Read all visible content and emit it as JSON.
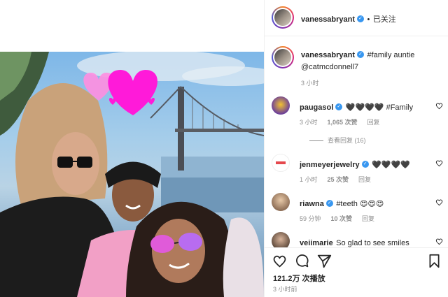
{
  "header": {
    "username": "vanessabryant",
    "separator": "•",
    "follow_state": "已关注"
  },
  "caption": {
    "username": "vanessabryant",
    "hashtag": "#family",
    "text": " auntie",
    "mention": "@catmcdonnell7",
    "time": "3 小时"
  },
  "comments": [
    {
      "username": "paugasol",
      "text": "🖤🖤🖤🖤 #Family",
      "time": "3 小时",
      "likes": "1,065 次赞",
      "reply": "回复",
      "view_replies": "查看回复 (16)"
    },
    {
      "username": "jenmeyerjewelry",
      "text": "🖤🖤🖤🖤",
      "time": "1 小时",
      "likes": "25 次赞",
      "reply": "回复"
    },
    {
      "username": "riawna",
      "text": "#teeth 😍😍😍",
      "time": "59 分钟",
      "likes": "10 次赞",
      "reply": "回复"
    },
    {
      "username": "veiimarie",
      "text": "So glad to see smiles"
    }
  ],
  "footer": {
    "likes": "121.2万 次播放",
    "time": "3 小时前"
  },
  "icons": {
    "like": "heart-outline-icon",
    "comment": "comment-bubble-icon",
    "share": "paper-plane-icon",
    "save": "bookmark-icon"
  },
  "colors": {
    "verified": "#3897f0",
    "hashtag": "#00376b",
    "sticker_heart": "#ff1ad9"
  }
}
